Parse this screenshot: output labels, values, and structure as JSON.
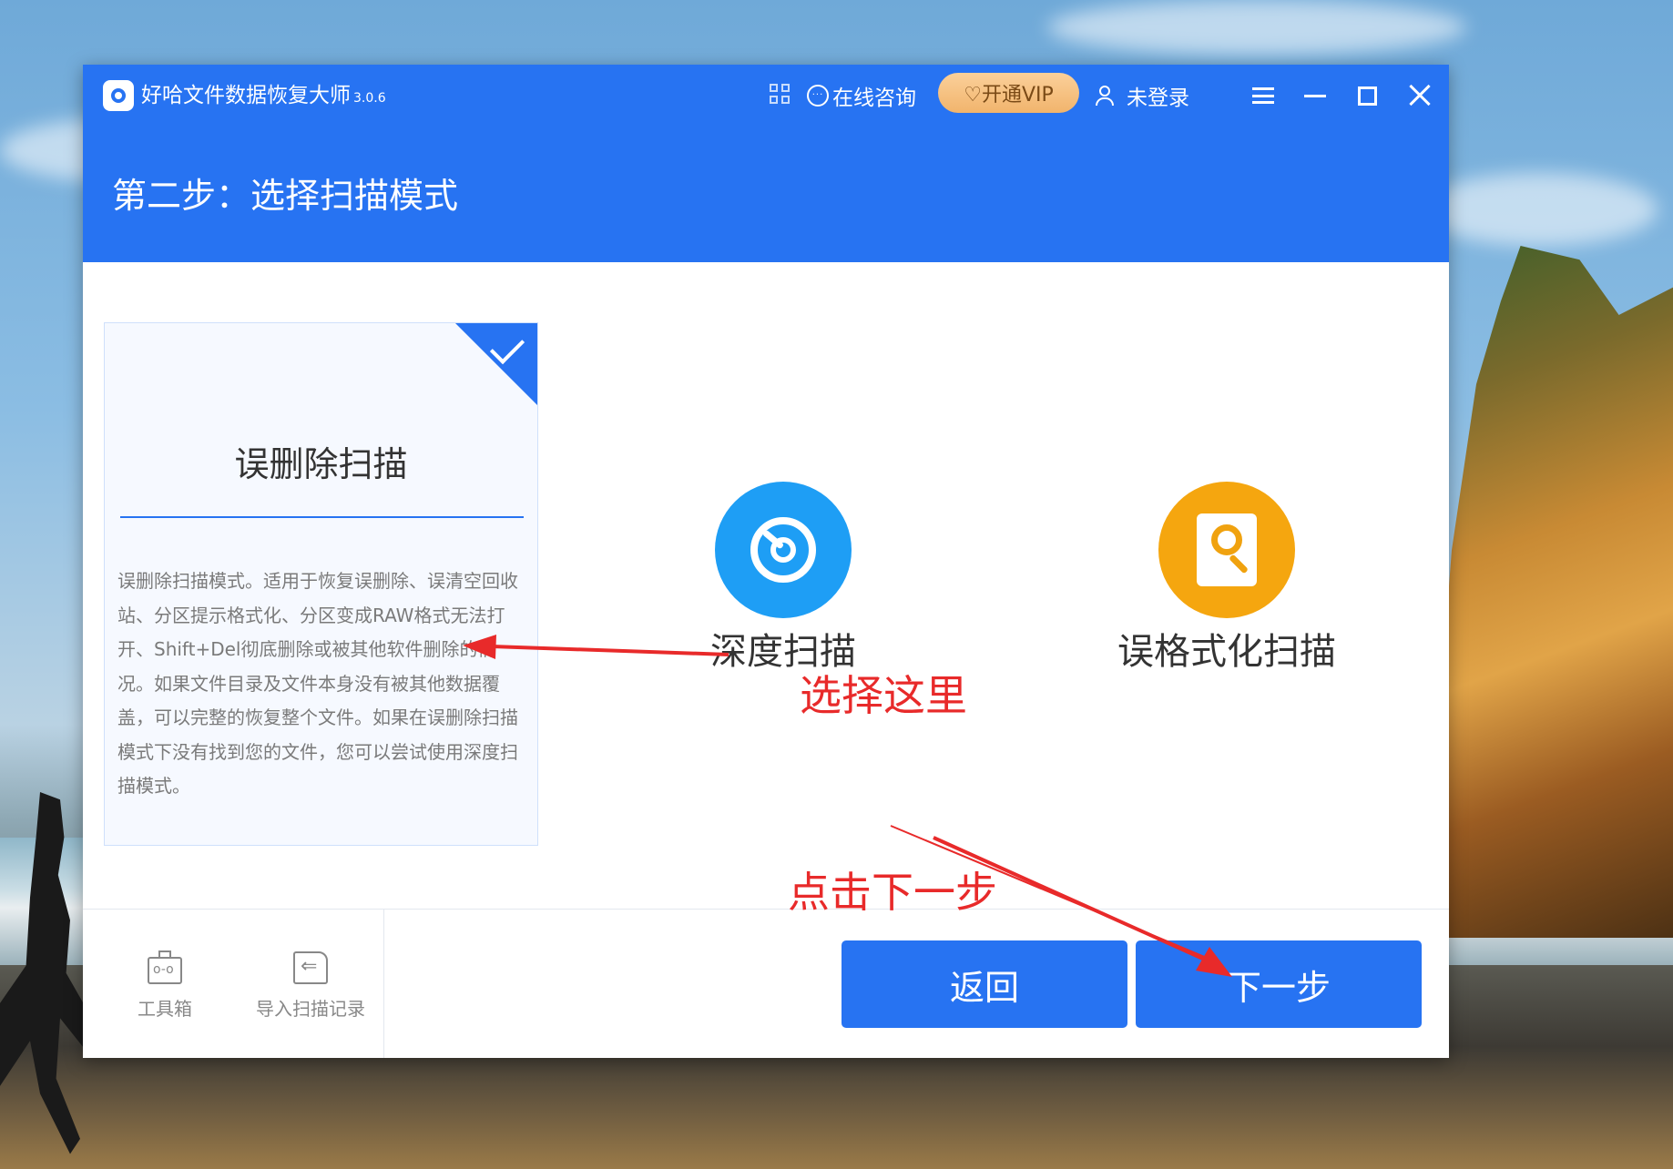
{
  "window": {
    "app_name": "好哈文件数据恢复大师",
    "version": "3.0.6",
    "online_consult_label": "在线咨询",
    "vip_label": "♡开通VIP",
    "login_label": "未登录",
    "brand_color": "#2773f2"
  },
  "step": {
    "title": "第二步：选择扫描模式"
  },
  "modes": {
    "selected": {
      "title": "误删除扫描",
      "description": "误删除扫描模式。适用于恢复误删除、误清空回收站、分区提示格式化、分区变成RAW格式无法打开、Shift+Del彻底删除或被其他软件删除的情况。如果文件目录及文件本身没有被其他数据覆盖，可以完整的恢复整个文件。如果在误删除扫描模式下没有找到您的文件，您可以尝试使用深度扫描模式。",
      "selected": true
    },
    "deep": {
      "label": "深度扫描",
      "color": "#1e9ef5"
    },
    "format": {
      "label": "误格式化扫描",
      "color": "#f5a60f"
    }
  },
  "footer": {
    "toolbox_label": "工具箱",
    "import_label": "导入扫描记录",
    "back_label": "返回",
    "next_label": "下一步"
  },
  "annotations": {
    "select_here": "选择这里",
    "click_next": "点击下一步",
    "color": "#e82a2a"
  }
}
